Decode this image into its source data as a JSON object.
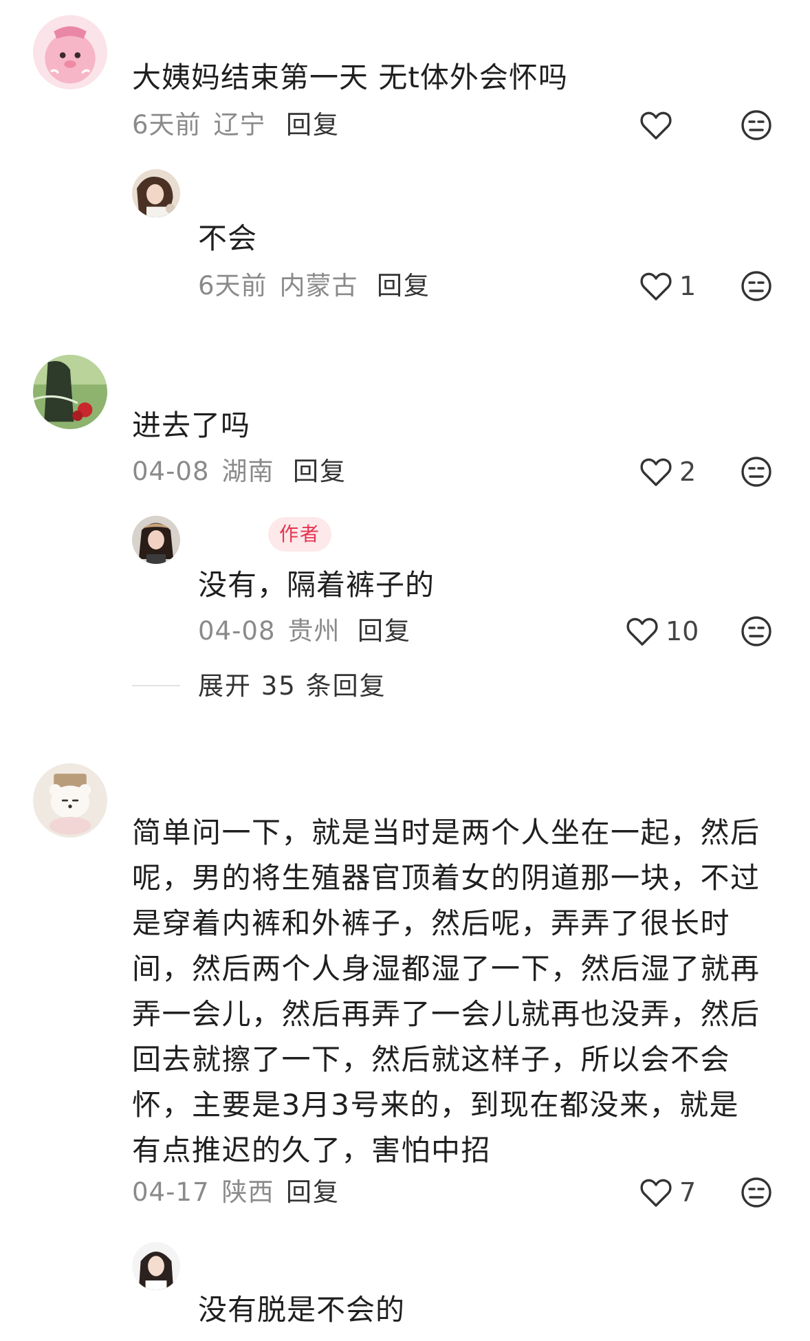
{
  "comments": [
    {
      "avatar": "pink-cartoon-avatar",
      "text": "大姨妈结束第一天 无t体外会怀吗",
      "date": "6天前",
      "location": "辽宁",
      "reply_label": "回复",
      "likes": "",
      "replies": [
        {
          "avatar": "girl-photo-avatar",
          "text": "不会",
          "date": "6天前",
          "location": "内蒙古",
          "reply_label": "回复",
          "likes": "1"
        }
      ]
    },
    {
      "avatar": "garden-photo-avatar",
      "text": "进去了吗",
      "date": "04-08",
      "location": "湖南",
      "reply_label": "回复",
      "likes": "2",
      "replies": [
        {
          "avatar": "girl-hat-avatar",
          "badge": "作者",
          "text": "没有，隔着裤子的",
          "date": "04-08",
          "location": "贵州",
          "reply_label": "回复",
          "likes": "10"
        }
      ],
      "expand_label": "展开 35 条回复"
    },
    {
      "avatar": "bear-plush-avatar",
      "text": "简单问一下，就是当时是两个人坐在一起，然后呢，男的将生殖器官顶着女的阴道那一块，不过是穿着内裤和外裤子，然后呢，弄弄了很长时间，然后两个人身湿都湿了一下，然后湿了就再弄一会儿，然后再弄了一会儿就再也没弄，然后回去就擦了一下，然后就这样子，所以会不会怀，主要是3月3号来的，到现在都没来，就是有点推迟的久了，害怕中招",
      "date": "04-17",
      "location": "陕西",
      "reply_label": "回复",
      "likes": "7",
      "replies": [
        {
          "avatar": "girl-white-avatar",
          "text": "没有脱是不会的"
        }
      ]
    }
  ],
  "colors": {
    "text": "#1f1f1f",
    "meta": "#8a8a8a",
    "badge_bg": "#fde8ea",
    "badge_text": "#e5354f"
  },
  "icons": {
    "like": "heart-outline-icon",
    "dislike": "meh-face-icon"
  }
}
